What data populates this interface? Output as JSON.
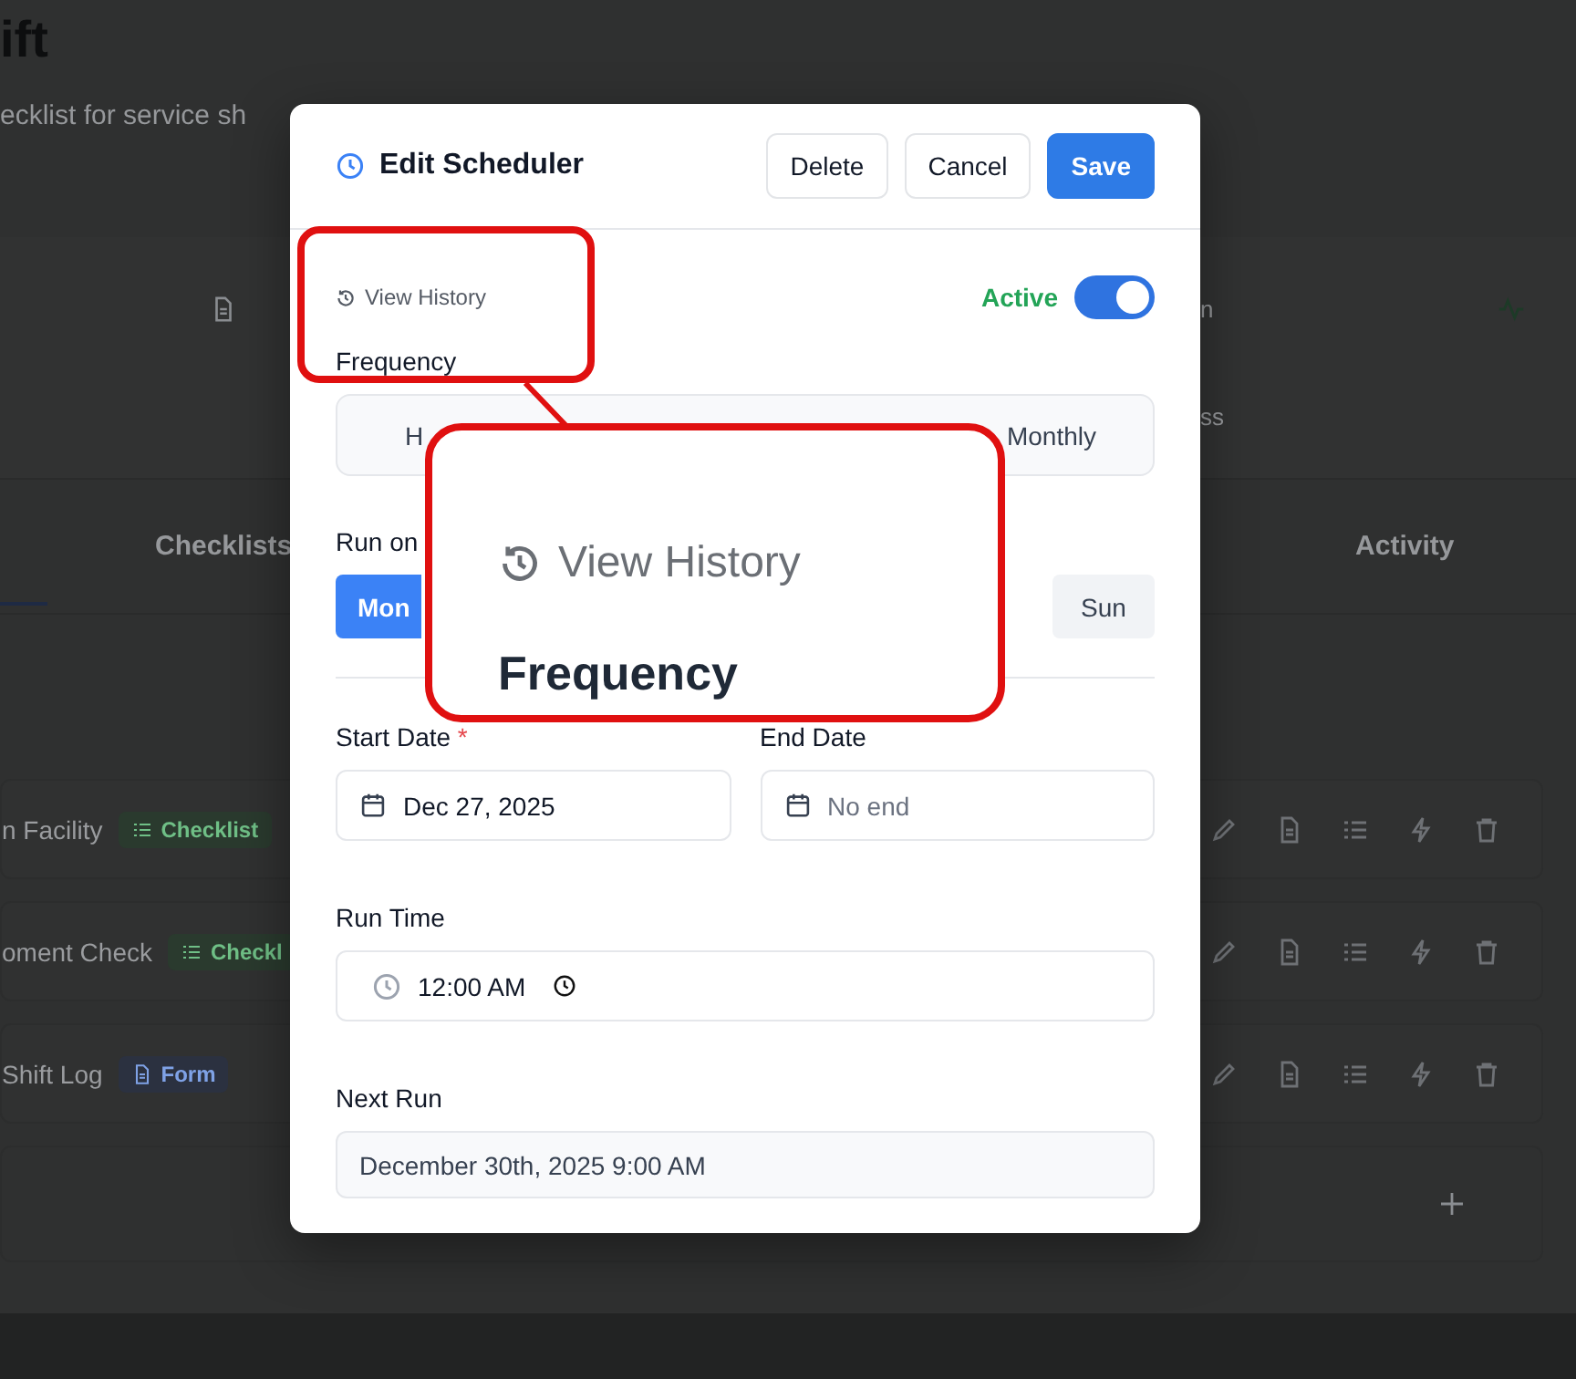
{
  "background": {
    "title": "ift",
    "subtitle": "ecklist for service sh",
    "stat_texts": [
      "n",
      "ss"
    ],
    "tabs": [
      {
        "label": "Checklists",
        "selected": false
      },
      {
        "label": "Activity",
        "selected": false
      }
    ],
    "rows": [
      {
        "name": "n Facility",
        "badge": {
          "label": "Checklist",
          "kind": "checklist"
        }
      },
      {
        "name": "oment Check",
        "badge": {
          "label": "Checkl",
          "kind": "checklist"
        }
      },
      {
        "name": "Shift Log",
        "badge": {
          "label": "Form",
          "kind": "form"
        }
      }
    ]
  },
  "dialog": {
    "title": "Edit Scheduler",
    "buttons": [
      {
        "label": "Delete",
        "kind": "secondary"
      },
      {
        "label": "Cancel",
        "kind": "secondary"
      },
      {
        "label": "Save",
        "kind": "primary"
      }
    ],
    "history_link": "View History",
    "status": {
      "label": "Active",
      "on": true
    },
    "frequency": {
      "label": "Frequency",
      "options": [
        {
          "label": "H",
          "selected": false
        },
        {
          "label": "Monthly",
          "selected": false
        }
      ]
    },
    "run_on": {
      "label": "Run on",
      "days": [
        {
          "label": "Mon",
          "selected": true
        },
        {
          "label": "Sun",
          "selected": false
        }
      ]
    },
    "start_date": {
      "label": "Start Date",
      "required_mark": "*",
      "value": "Dec 27, 2025"
    },
    "end_date": {
      "label": "End Date",
      "placeholder": "No end"
    },
    "run_time": {
      "label": "Run Time",
      "value": "12:00 AM"
    },
    "next_run": {
      "label": "Next Run",
      "value": "December 30th, 2025 9:00 AM"
    }
  },
  "callout": {
    "text": "View History",
    "text_below": "Frequency"
  }
}
